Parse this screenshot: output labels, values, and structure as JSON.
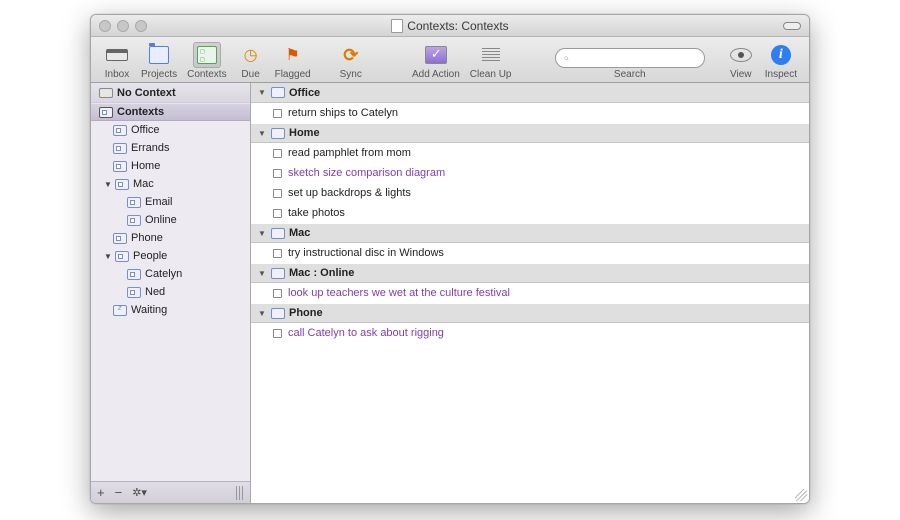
{
  "window": {
    "title": "Contexts: Contexts"
  },
  "toolbar": {
    "inbox": {
      "label": "Inbox"
    },
    "projects": {
      "label": "Projects"
    },
    "contexts": {
      "label": "Contexts"
    },
    "due": {
      "label": "Due"
    },
    "flagged": {
      "label": "Flagged"
    },
    "sync": {
      "label": "Sync"
    },
    "add": {
      "label": "Add Action"
    },
    "cleanup": {
      "label": "Clean Up"
    },
    "search": {
      "label": "Search",
      "placeholder": ""
    },
    "view": {
      "label": "View"
    },
    "inspect": {
      "label": "Inspect"
    }
  },
  "sidebar": {
    "no_context": "No Context",
    "contexts_header": "Contexts",
    "items": [
      {
        "label": "Office"
      },
      {
        "label": "Errands"
      },
      {
        "label": "Home"
      },
      {
        "label": "Mac"
      },
      {
        "label": "Email"
      },
      {
        "label": "Online"
      },
      {
        "label": "Phone"
      },
      {
        "label": "People"
      },
      {
        "label": "Catelyn"
      },
      {
        "label": "Ned"
      },
      {
        "label": "Waiting"
      }
    ]
  },
  "footer": {
    "add": "+",
    "remove": "−",
    "gear": "✻▾"
  },
  "groups": [
    {
      "name": "Office",
      "tasks": [
        {
          "text": "return ships to Catelyn",
          "flagged": false
        }
      ]
    },
    {
      "name": "Home",
      "tasks": [
        {
          "text": "read pamphlet from mom",
          "flagged": false
        },
        {
          "text": "sketch size comparison diagram",
          "flagged": true
        },
        {
          "text": "set up backdrops & lights",
          "flagged": false
        },
        {
          "text": "take photos",
          "flagged": false
        }
      ]
    },
    {
      "name": "Mac",
      "tasks": [
        {
          "text": "try instructional disc in Windows",
          "flagged": false
        }
      ]
    },
    {
      "name": "Mac : Online",
      "tasks": [
        {
          "text": "look up teachers we wet at the culture festival",
          "flagged": true
        }
      ]
    },
    {
      "name": "Phone",
      "tasks": [
        {
          "text": "call Catelyn to ask about rigging",
          "flagged": true
        }
      ]
    }
  ]
}
